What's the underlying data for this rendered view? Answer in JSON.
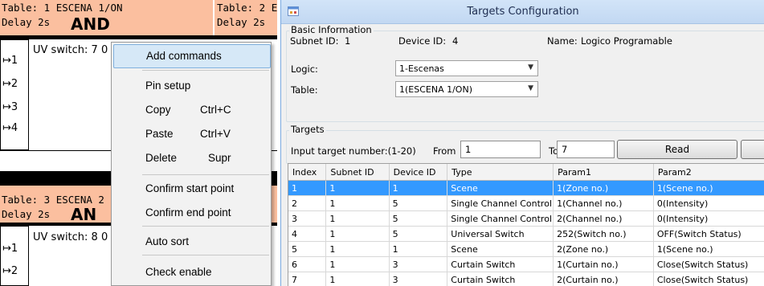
{
  "logic_editor": {
    "table1": {
      "title": "Table: 1 ESCENA 1/ON",
      "delay": "Delay 2s",
      "operator": "AND"
    },
    "table2": {
      "title": "Table: 2 ES",
      "delay": "Delay 2s"
    },
    "table3": {
      "title": "Table: 3 ESCENA 2",
      "delay": "Delay 2s",
      "operator": "AN"
    },
    "table1_pins": [
      "↦1",
      "↦2",
      "↦3",
      "↦4"
    ],
    "table3_pins": [
      "↦1",
      "↦2"
    ],
    "uv1": "UV switch: 7 0",
    "uv3": "UV switch: 8 0"
  },
  "context_menu": {
    "items": [
      {
        "label": "Add commands",
        "shortcut": ""
      },
      {
        "label": "Pin setup",
        "shortcut": ""
      },
      {
        "label": "Copy",
        "shortcut": "Ctrl+C"
      },
      {
        "label": "Paste",
        "shortcut": "Ctrl+V"
      },
      {
        "label": "Delete",
        "shortcut": "Supr"
      },
      {
        "label": "Confirm start point",
        "shortcut": ""
      },
      {
        "label": "Confirm end point",
        "shortcut": ""
      },
      {
        "label": "Auto sort",
        "shortcut": ""
      },
      {
        "label": "Check enable",
        "shortcut": ""
      }
    ]
  },
  "window": {
    "title": "Targets Configuration",
    "basic_info": {
      "group_label": "Basic Information",
      "subnet_label": "Subnet ID:",
      "subnet_value": "1",
      "device_label": "Device ID:",
      "device_value": "4",
      "name_label": "Name:",
      "name_value": "Logico Programable",
      "logic_label": "Logic:",
      "logic_value": "1-Escenas",
      "table_label": "Table:",
      "table_value": "1(ESCENA 1/ON)"
    },
    "targets": {
      "group_label": "Targets",
      "input_label": "Input target number:(1-20)",
      "from_label": "From",
      "from_value": "1",
      "to_label": "To",
      "to_value": "7",
      "read_button": "Read"
    },
    "grid": {
      "columns": [
        "Index",
        "Subnet ID",
        "Device ID",
        "Type",
        "Param1",
        "Param2"
      ],
      "rows": [
        [
          "1",
          "1",
          "1",
          "Scene",
          "1(Zone no.)",
          "1(Scene no.)"
        ],
        [
          "2",
          "1",
          "5",
          "Single Channel Control",
          "1(Channel no.)",
          "0(Intensity)"
        ],
        [
          "3",
          "1",
          "5",
          "Single Channel Control",
          "2(Channel no.)",
          "0(Intensity)"
        ],
        [
          "4",
          "1",
          "5",
          "Universal Switch",
          "252(Switch no.)",
          "OFF(Switch Status)"
        ],
        [
          "5",
          "1",
          "1",
          "Scene",
          "2(Zone no.)",
          "1(Scene no.)"
        ],
        [
          "6",
          "1",
          "3",
          "Curtain Switch",
          "1(Curtain no.)",
          "Close(Switch Status)"
        ],
        [
          "7",
          "1",
          "3",
          "Curtain Switch",
          "2(Curtain no.)",
          "Close(Switch Status)"
        ]
      ],
      "selected_row": 0
    }
  }
}
